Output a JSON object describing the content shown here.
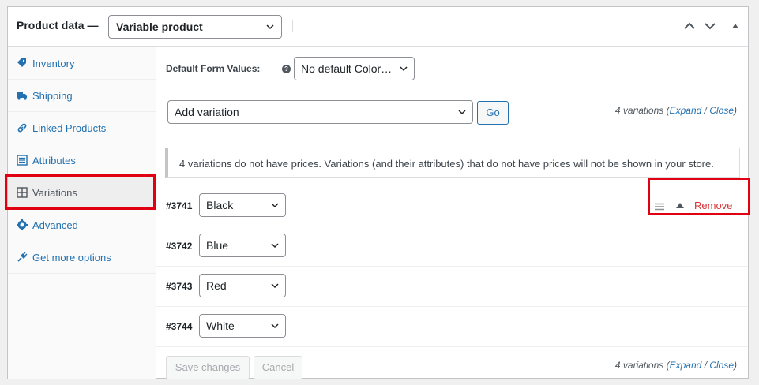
{
  "header": {
    "title": "Product data",
    "dash": "—",
    "product_type": "Variable product"
  },
  "sidebar": {
    "items": [
      {
        "label": "Inventory",
        "icon": "tag-icon"
      },
      {
        "label": "Shipping",
        "icon": "truck-icon"
      },
      {
        "label": "Linked Products",
        "icon": "link-icon"
      },
      {
        "label": "Attributes",
        "icon": "list-icon"
      },
      {
        "label": "Variations",
        "icon": "grid-icon",
        "active": true
      },
      {
        "label": "Advanced",
        "icon": "gear-icon"
      },
      {
        "label": "Get more options",
        "icon": "plugin-icon"
      }
    ]
  },
  "main": {
    "default_form_values_label": "Default Form Values:",
    "help_icon_text": "?",
    "default_select": "No default Color…",
    "add_variation_select": "Add variation",
    "go_button": "Go",
    "count_top": {
      "text": "4 variations (",
      "expand": "Expand",
      "sep": " / ",
      "close": "Close",
      "end": ")"
    },
    "notice": "4 variations do not have prices. Variations (and their attributes) that do not have prices will not be shown in your store.",
    "variations": [
      {
        "id": "#3741",
        "value": "Black"
      },
      {
        "id": "#3742",
        "value": "Blue"
      },
      {
        "id": "#3743",
        "value": "Red"
      },
      {
        "id": "#3744",
        "value": "White"
      }
    ],
    "remove_label": "Remove",
    "save_button": "Save changes",
    "cancel_button": "Cancel",
    "count_bottom": {
      "text": "4 variations (",
      "expand": "Expand",
      "sep": " / ",
      "close": "Close",
      "end": ")"
    }
  },
  "colors": {
    "accent": "#2271b1",
    "remove": "#d63638",
    "highlight": "#e00012"
  }
}
